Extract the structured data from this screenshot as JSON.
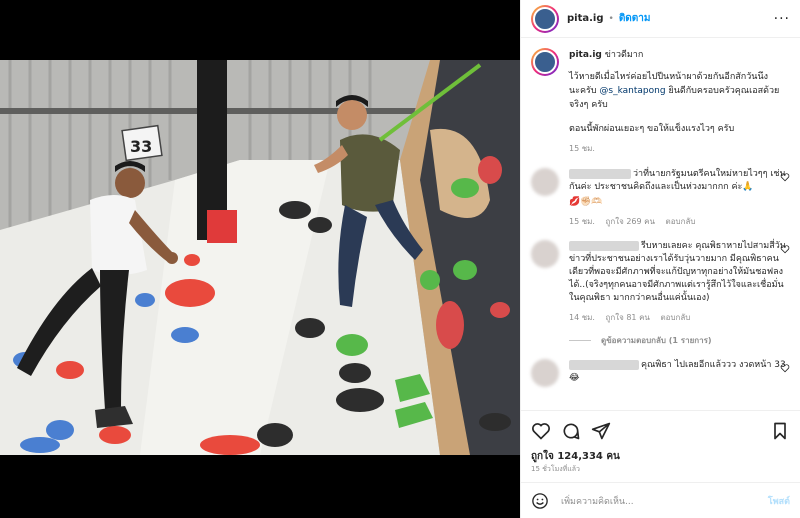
{
  "post": {
    "username": "pita.ig",
    "separator": "•",
    "follow_label": "ติดตาม",
    "more_label": "···"
  },
  "caption": {
    "username": "pita.ig",
    "title": "ข่าวดีมาก",
    "line1": "ไว้หายดีเมื่อไหร่ค่อยไปปีนหน้าผาด้วยกันอีกสักวันนึง",
    "line2_prefix": "นะครับ ",
    "mention": "@s_kantapong",
    "line2_suffix": " ยินดีกับครอบครัวคุณเอสด้วย",
    "line3": "จริงๆ ครับ",
    "line4": "ตอนนี้พักผ่อนเยอะๆ ขอให้แข็งแรงไวๆ ครับ",
    "time": "15 ชม."
  },
  "comments": [
    {
      "text": "ว่าที่นายกรัฐมนตรีคนใหม่หายไวๆๆ เช่นกันค่ะ ประชาชนคิดถึงและเป็นห่วงมากกก ค่ะ🙏",
      "text2": "💋✊🏻🫶🏻",
      "time": "15 ชม.",
      "likes": "ถูกใจ 269 คน",
      "reply": "ตอบกลับ"
    },
    {
      "text": "รีบหายเลยคะ คุณพิธาหายไปสามสี่วันข่าวที่ประชาชนอย่างเราได้รับวุ่นวายมาก มีคุณพิธาคนเดียวที่พอจะมีศักภาพที่จะแก้ปัญหาทุกอย่างให้มันชอฟลงได้..(จริงๆทุกคนอาจมีศักภาพแต่เรารู้สึกไว้ใจและเชื่อมั่นในคุณพิธา มากกว่าคนอื่นแค่นั้นเอง)",
      "time": "14 ชม.",
      "likes": "ถูกใจ 81 คน",
      "reply": "ตอบกลับ",
      "view_replies": "ดูข้อความตอบกลับ (1 รายการ)"
    },
    {
      "text": "คุณพิธา ไปเลยอีกแล้ววว งวดหน้า 33😂"
    }
  ],
  "actions": {
    "likes": "ถูกใจ 124,334 คน",
    "time": "15 ชั่วโมงที่แล้ว"
  },
  "add_comment": {
    "placeholder": "เพิ่มความคิดเห็น...",
    "post_label": "โพสต์"
  },
  "photo": {
    "wall_number": "33"
  },
  "colors": {
    "accent": "#0095f6",
    "mention": "#00376b",
    "muted": "#8e8e8e"
  }
}
